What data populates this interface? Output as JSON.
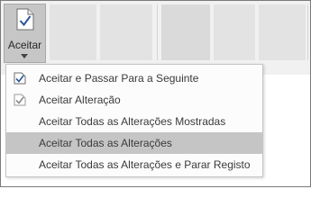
{
  "ribbon": {
    "accept_button": {
      "label": "Aceitar",
      "icon": "document-check-icon",
      "caret_icon": "chevron-down-icon"
    }
  },
  "menu": {
    "items": [
      {
        "label": "Aceitar e Passar Para a Seguinte",
        "icon": "accept-and-move-icon",
        "highlighted": false
      },
      {
        "label": "Aceitar Alteração",
        "icon": "accept-change-icon",
        "highlighted": false
      },
      {
        "label": "Aceitar Todas as Alterações Mostradas",
        "icon": "",
        "highlighted": false
      },
      {
        "label": "Aceitar Todas as Alterações",
        "icon": "",
        "highlighted": true
      },
      {
        "label": "Aceitar Todas as Alterações e Parar Registo",
        "icon": "",
        "highlighted": false
      }
    ]
  },
  "colors": {
    "ribbon_bg": "#f1f1f1",
    "button_pressed": "#c6c6c6",
    "menu_highlight": "#c5c5c5",
    "check_blue": "#2b579a"
  }
}
